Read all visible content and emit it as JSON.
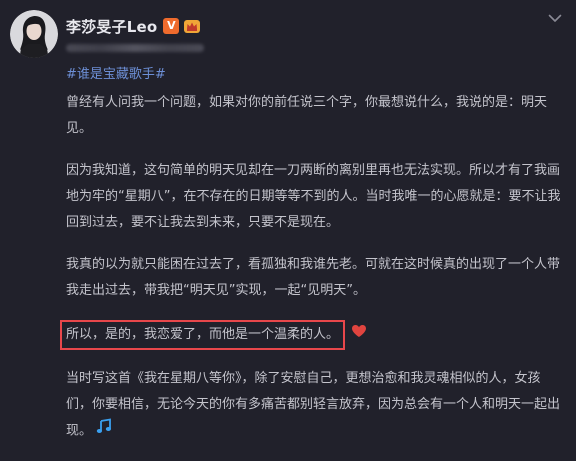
{
  "post": {
    "author": {
      "name": "李莎旻子Leo",
      "verified_badge_text": "V",
      "badge_icon": "crown-icon",
      "avatar_icon": "avatar"
    },
    "hashtag": "#谁是宝藏歌手#",
    "paragraphs": [
      "曾经有人问我一个问题，如果对你的前任说三个字，你最想说什么，我说的是：明天见。",
      "因为我知道，这句简单的明天见却在一刀两断的离别里再也无法实现。所以才有了我画地为牢的“星期八”，在不存在的日期等等不到的人。当时我唯一的心愿就是：要不让我回到过去，要不让我去到未来，只要不是现在。",
      "我真的以为就只能困在过去了，看孤独和我谁先老。可就在这时候真的出现了一个人带我走出过去，带我把“明天见”实现，一起“见明天”。"
    ],
    "highlighted": "所以，是的，我恋爱了，而他是一个温柔的人。",
    "last_paragraph": "当时写这首《我在星期八等你》，除了安慰自己，更想治愈和我灵魂相似的人，女孩们，你要相信，无论今天的你有多痛苦都别轻言放弃，因为总会有一个人和明天一起出现。"
  },
  "colors": {
    "background": "#21212b",
    "text": "#c4c4cc",
    "hashtag": "#6d8fd6",
    "highlight_border": "#e8474b",
    "heart": "#e0443f",
    "music_note": "#3aa0f0",
    "verified": "#ef6b2d"
  }
}
